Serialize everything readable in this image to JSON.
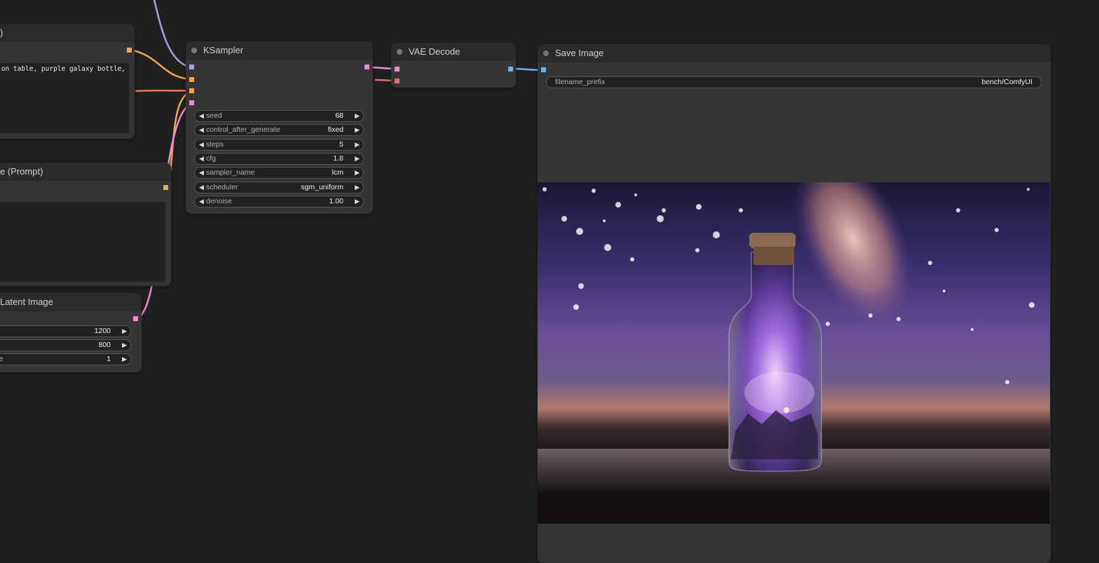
{
  "nodes": {
    "clip_positive": {
      "title": ")",
      "prompt_text": " on table, purple galaxy bottle,"
    },
    "clip_negative": {
      "title": "e (Prompt)"
    },
    "empty_latent": {
      "title": "Latent Image",
      "widgets": [
        {
          "label": "",
          "value": "1200"
        },
        {
          "label": "",
          "value": "800"
        },
        {
          "label": "ize",
          "value": "1"
        }
      ]
    },
    "ksampler": {
      "title": "KSampler",
      "widgets": [
        {
          "label": "seed",
          "value": "68"
        },
        {
          "label": "control_after_generate",
          "value": "fixed"
        },
        {
          "label": "steps",
          "value": "5"
        },
        {
          "label": "cfg",
          "value": "1.8"
        },
        {
          "label": "sampler_name",
          "value": "lcm"
        },
        {
          "label": "scheduler",
          "value": "sgm_uniform"
        },
        {
          "label": "denoise",
          "value": "1.00"
        }
      ]
    },
    "vae_decode": {
      "title": "VAE Decode"
    },
    "save_image": {
      "title": "Save Image",
      "filename_prefix_label": "filename_prefix",
      "filename_prefix_value": "bench/ComfyUI"
    }
  },
  "colors": {
    "model": "#b39ddb",
    "clip": "#f0a94b",
    "conditioning": "#e08a7a",
    "latent": "#f18bd9",
    "vae": "#e86b6b",
    "image": "#64b5f6"
  },
  "icons": {
    "arrow_left": "◀",
    "arrow_right": "▶"
  }
}
